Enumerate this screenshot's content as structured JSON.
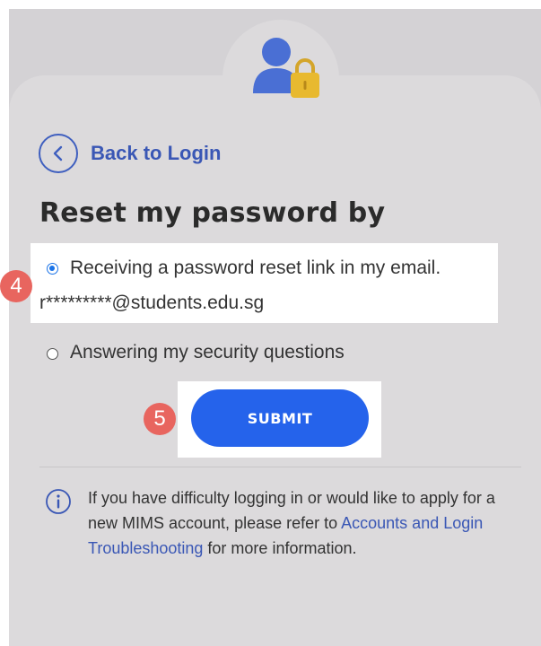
{
  "back_link": {
    "label": "Back to Login"
  },
  "title": "Reset my password by",
  "options": [
    {
      "label": "Receiving a password reset link in my email.",
      "selected": true,
      "detail": "r*********@students.edu.sg"
    },
    {
      "label": "Answering my security questions",
      "selected": false
    }
  ],
  "submit_label": "SUBMIT",
  "step_badges": {
    "email_option": "4",
    "submit": "5"
  },
  "info": {
    "text_before": "If you have difficulty logging in or would like to apply for a new MIMS account, please refer to ",
    "link_text": "Accounts and Login Troubleshooting",
    "text_after": " for more information."
  },
  "icons": {
    "avatar": "user-lock-icon",
    "back": "chevron-left-icon",
    "info": "info-circle-icon"
  },
  "colors": {
    "primary": "#2563eb",
    "link": "#3a57b5",
    "badge": "#e8655f",
    "lock": "#e8b92f",
    "user": "#4a6fd4"
  }
}
